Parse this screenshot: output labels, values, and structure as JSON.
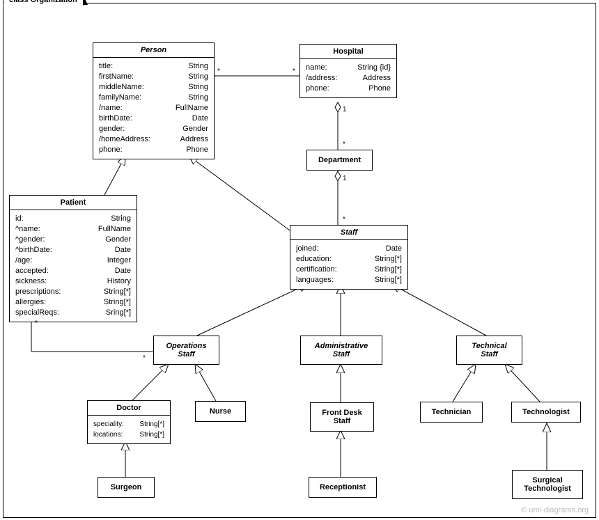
{
  "frame": {
    "title": "class Organization"
  },
  "classes": {
    "person": {
      "name": "Person",
      "attrs": [
        [
          "title:",
          "String"
        ],
        [
          "firstName:",
          "String"
        ],
        [
          "middleName:",
          "String"
        ],
        [
          "familyName:",
          "String"
        ],
        [
          "/name:",
          "FullName"
        ],
        [
          "birthDate:",
          "Date"
        ],
        [
          "gender:",
          "Gender"
        ],
        [
          "/homeAddress:",
          "Address"
        ],
        [
          "phone:",
          "Phone"
        ]
      ]
    },
    "hospital": {
      "name": "Hospital",
      "attrs": [
        [
          "name:",
          "String {id}"
        ],
        [
          "/address:",
          "Address"
        ],
        [
          "phone:",
          "Phone"
        ]
      ]
    },
    "department": {
      "name": "Department"
    },
    "patient": {
      "name": "Patient",
      "attrs": [
        [
          "id:",
          "String"
        ],
        [
          "^name:",
          "FullName"
        ],
        [
          "^gender:",
          "Gender"
        ],
        [
          "^birthDate:",
          "Date"
        ],
        [
          "/age:",
          "Integer"
        ],
        [
          "accepted:",
          "Date"
        ],
        [
          "sickness:",
          "History"
        ],
        [
          "prescriptions:",
          "String[*]"
        ],
        [
          "allergies:",
          "String[*]"
        ],
        [
          "specialReqs:",
          "Sring[*]"
        ]
      ]
    },
    "staff": {
      "name": "Staff",
      "attrs": [
        [
          "joined:",
          "Date"
        ],
        [
          "education:",
          "String[*]"
        ],
        [
          "certification:",
          "String[*]"
        ],
        [
          "languages:",
          "String[*]"
        ]
      ]
    },
    "operationsStaff": {
      "name": "Operations\nStaff"
    },
    "administrativeStaff": {
      "name": "Administrative\nStaff"
    },
    "technicalStaff": {
      "name": "Technical\nStaff"
    },
    "doctor": {
      "name": "Doctor",
      "attrs": [
        [
          "speciality:",
          "String[*]"
        ],
        [
          "locations:",
          "String[*]"
        ]
      ]
    },
    "nurse": {
      "name": "Nurse"
    },
    "frontDeskStaff": {
      "name": "Front Desk\nStaff"
    },
    "technician": {
      "name": "Technician"
    },
    "technologist": {
      "name": "Technologist"
    },
    "surgeon": {
      "name": "Surgeon"
    },
    "receptionist": {
      "name": "Receptionist"
    },
    "surgicalTechnologist": {
      "name": "Surgical\nTechnologist"
    }
  },
  "multiplicities": {
    "person_hosp_l": "*",
    "person_hosp_r": "*",
    "hosp_dept_top": "1",
    "hosp_dept_bot": "*",
    "dept_staff_top": "1",
    "dept_staff_bot": "*",
    "patient_ops_l": "*",
    "patient_ops_r": "*"
  },
  "watermark": "© uml-diagrams.org"
}
